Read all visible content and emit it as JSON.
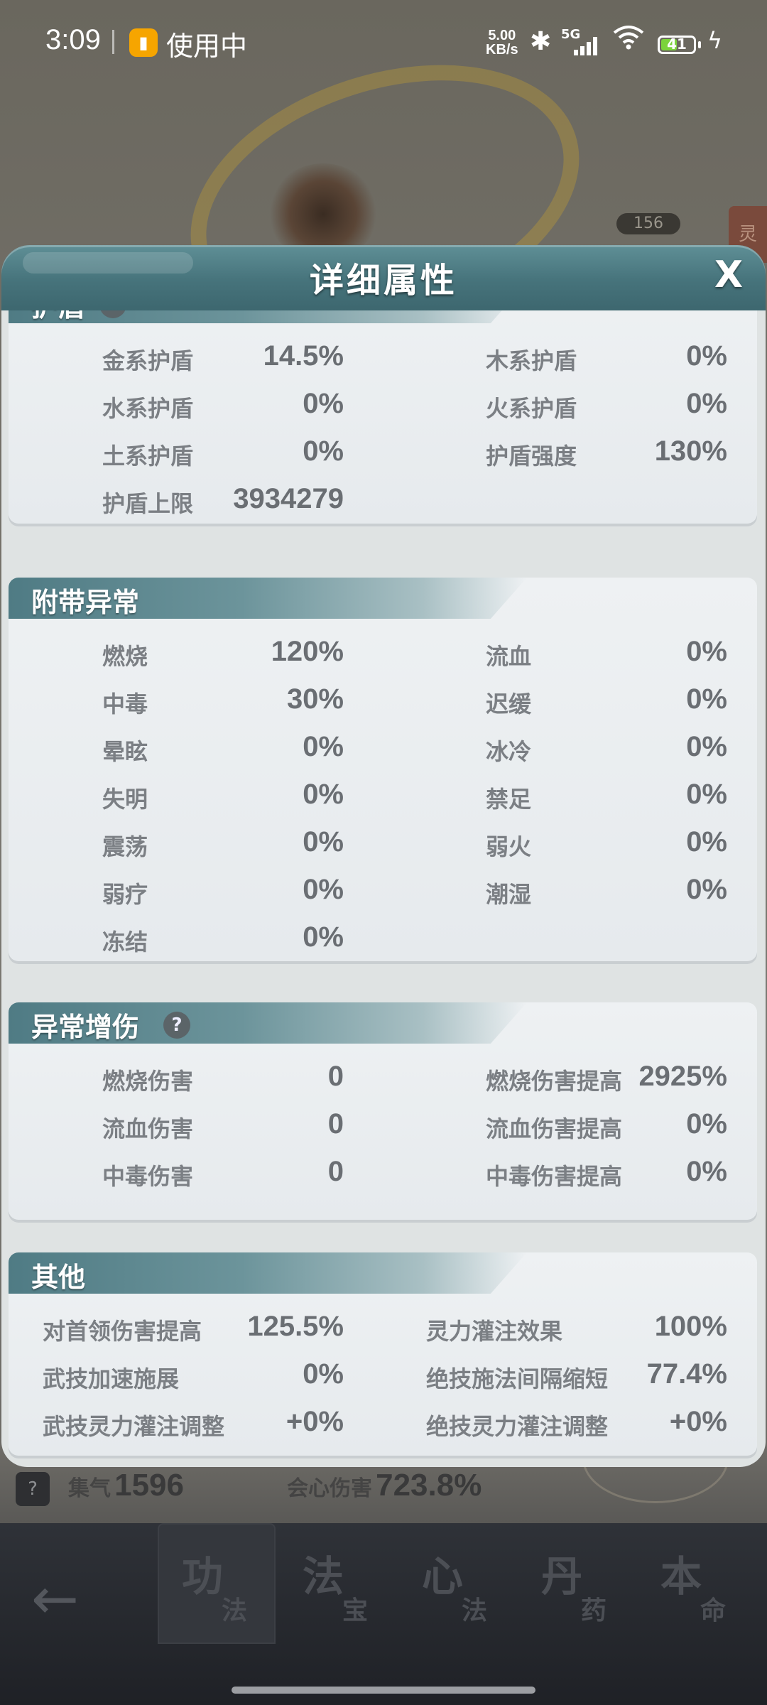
{
  "status_bar": {
    "time": "3:09",
    "app_indicator": "使用中",
    "net_speed_value": "5.00",
    "net_speed_unit": "KB/s",
    "signal_label": "5G",
    "battery": "41"
  },
  "background": {
    "badge_value": "156",
    "side_glyph": "灵"
  },
  "dialog": {
    "title": "详细属性",
    "close_label": "X",
    "sections": {
      "shield": {
        "title": "护盾",
        "left": [
          {
            "label": "金系护盾",
            "value": "14.5%"
          },
          {
            "label": "水系护盾",
            "value": "0%"
          },
          {
            "label": "土系护盾",
            "value": "0%"
          },
          {
            "label": "护盾上限",
            "value": "3934279"
          }
        ],
        "right": [
          {
            "label": "木系护盾",
            "value": "0%"
          },
          {
            "label": "火系护盾",
            "value": "0%"
          },
          {
            "label": "护盾强度",
            "value": "130%"
          }
        ]
      },
      "status": {
        "title": "附带异常",
        "left": [
          {
            "label": "燃烧",
            "value": "120%"
          },
          {
            "label": "中毒",
            "value": "30%"
          },
          {
            "label": "晕眩",
            "value": "0%"
          },
          {
            "label": "失明",
            "value": "0%"
          },
          {
            "label": "震荡",
            "value": "0%"
          },
          {
            "label": "弱疗",
            "value": "0%"
          },
          {
            "label": "冻结",
            "value": "0%"
          }
        ],
        "right": [
          {
            "label": "流血",
            "value": "0%"
          },
          {
            "label": "迟缓",
            "value": "0%"
          },
          {
            "label": "冰冷",
            "value": "0%"
          },
          {
            "label": "禁足",
            "value": "0%"
          },
          {
            "label": "弱火",
            "value": "0%"
          },
          {
            "label": "潮湿",
            "value": "0%"
          }
        ]
      },
      "status_dmg": {
        "title": "异常增伤",
        "left": [
          {
            "label": "燃烧伤害",
            "value": "0"
          },
          {
            "label": "流血伤害",
            "value": "0"
          },
          {
            "label": "中毒伤害",
            "value": "0"
          }
        ],
        "right": [
          {
            "label": "燃烧伤害提高",
            "value": "2925%"
          },
          {
            "label": "流血伤害提高",
            "value": "0%"
          },
          {
            "label": "中毒伤害提高",
            "value": "0%"
          }
        ]
      },
      "other": {
        "title": "其他",
        "left": [
          {
            "label": "对首领伤害提高",
            "value": "125.5%"
          },
          {
            "label": "武技加速施展",
            "value": "0%"
          },
          {
            "label": "武技灵力灌注调整",
            "value": "+0%"
          }
        ],
        "right": [
          {
            "label": "灵力灌注效果",
            "value": "100%"
          },
          {
            "label": "绝技施法间隔缩短",
            "value": "77.4%"
          },
          {
            "label": "绝技灵力灌注调整",
            "value": "+0%"
          }
        ]
      }
    }
  },
  "bottom_stats": {
    "q": "?",
    "qi_label": "集气",
    "qi_value": "1596",
    "crit_label": "会心伤害",
    "crit_value": "723.8%"
  },
  "nav": {
    "tabs": [
      {
        "big": "功",
        "small": "法"
      },
      {
        "big": "法",
        "small": "宝"
      },
      {
        "big": "心",
        "small": "法"
      },
      {
        "big": "丹",
        "small": "药"
      },
      {
        "big": "本",
        "small": "命"
      }
    ]
  },
  "colors": {
    "header_teal": "#46737b",
    "card_bg": "#eef1f3",
    "label_gray": "#7b7f84",
    "value_gray": "#6a6e73",
    "battery_green": "#7bd33b",
    "app_icon": "#f6a500"
  }
}
